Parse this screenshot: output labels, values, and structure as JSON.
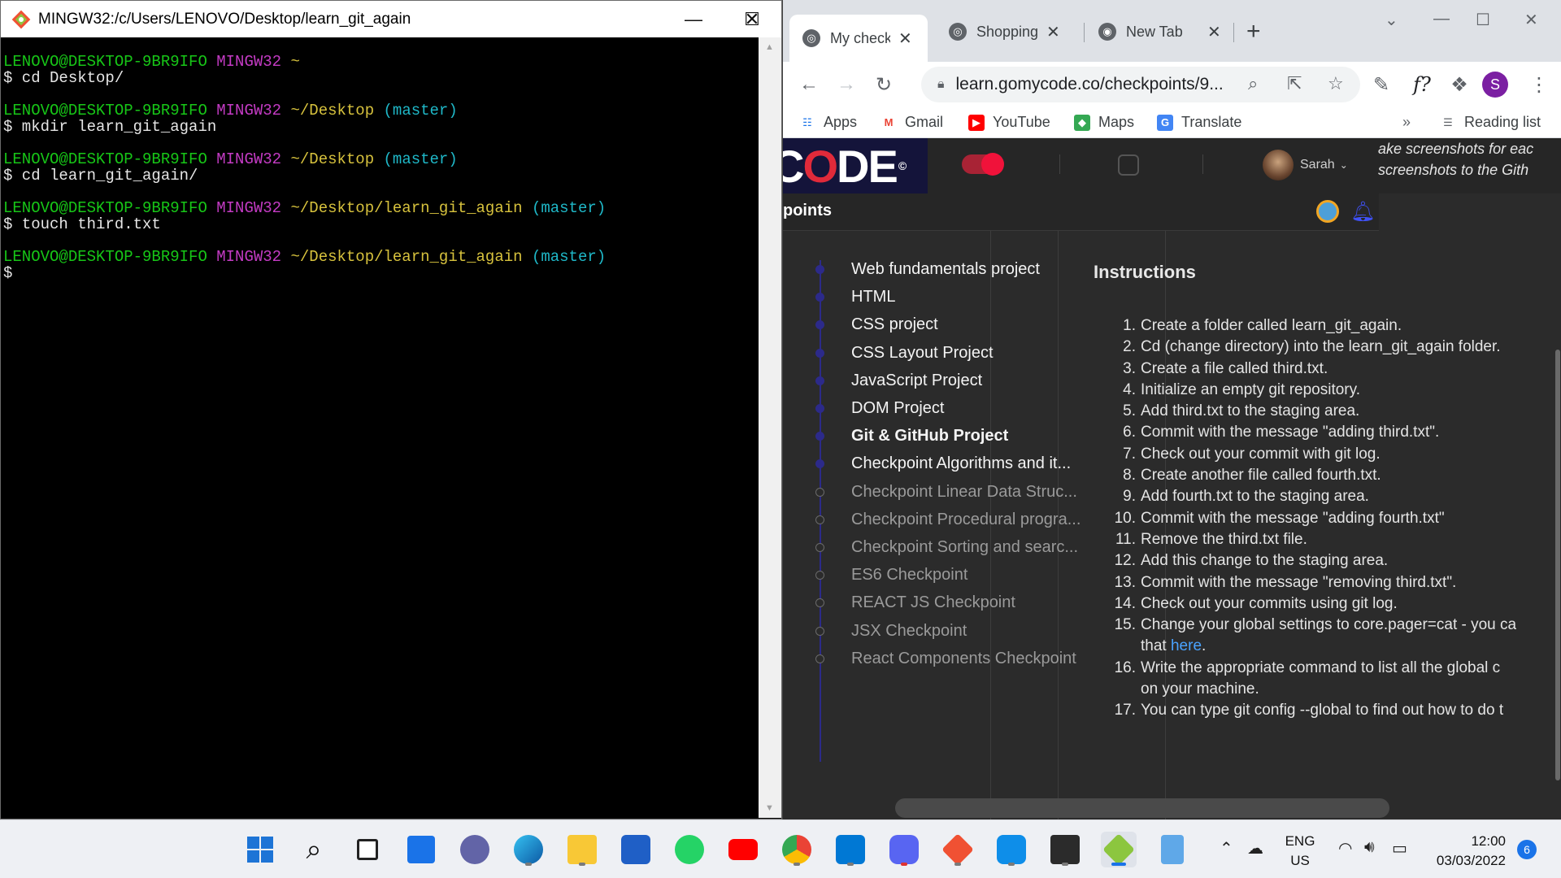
{
  "terminal": {
    "title": "MINGW32:/c/Users/LENOVO/Desktop/learn_git_again",
    "lines": [
      {
        "user": "LENOVO@DESKTOP-9BR9IFO",
        "sys": "MINGW32",
        "path": "~",
        "branch": ""
      },
      {
        "cmd": "$ cd Desktop/"
      },
      {
        "blank": ""
      },
      {
        "user": "LENOVO@DESKTOP-9BR9IFO",
        "sys": "MINGW32",
        "path": "~/Desktop",
        "branch": "(master)"
      },
      {
        "cmd": "$ mkdir learn_git_again"
      },
      {
        "blank": ""
      },
      {
        "user": "LENOVO@DESKTOP-9BR9IFO",
        "sys": "MINGW32",
        "path": "~/Desktop",
        "branch": "(master)"
      },
      {
        "cmd": "$ cd learn_git_again/"
      },
      {
        "blank": ""
      },
      {
        "user": "LENOVO@DESKTOP-9BR9IFO",
        "sys": "MINGW32",
        "path": "~/Desktop/learn_git_again",
        "branch": "(master)"
      },
      {
        "cmd": "$ touch third.txt"
      },
      {
        "blank": ""
      },
      {
        "user": "LENOVO@DESKTOP-9BR9IFO",
        "sys": "MINGW32",
        "path": "~/Desktop/learn_git_again",
        "branch": "(master)"
      },
      {
        "cmd": "$"
      }
    ]
  },
  "browser": {
    "tabs": [
      {
        "label": "My checkp",
        "icon": "globe-icon",
        "active": true
      },
      {
        "label": "Shopping",
        "icon": "globe-icon",
        "active": false
      },
      {
        "label": "New Tab",
        "icon": "chrome-icon",
        "active": false
      }
    ],
    "url": "learn.gomycode.co/checkpoints/9...",
    "profile_initial": "S",
    "bookmarks": [
      "Apps",
      "Gmail",
      "YouTube",
      "Maps",
      "Translate"
    ],
    "reading_list": "Reading list"
  },
  "site": {
    "logo_text": "CODE",
    "logo_mark": "©",
    "user_name": "Sarah",
    "overflow_lines": [
      "ake screenshots for eac",
      "screenshots to the Gith"
    ],
    "breadcrumb": "points",
    "steps": [
      {
        "label": "Web fundamentals project",
        "state": "done"
      },
      {
        "label": "HTML",
        "state": "done"
      },
      {
        "label": "CSS project",
        "state": "done"
      },
      {
        "label": "CSS Layout Project",
        "state": "done"
      },
      {
        "label": "JavaScript Project",
        "state": "done"
      },
      {
        "label": "DOM Project",
        "state": "done"
      },
      {
        "label": "Git & GitHub Project",
        "state": "current"
      },
      {
        "label": "Checkpoint Algorithms and it...",
        "state": "done"
      },
      {
        "label": "Checkpoint Linear Data Struc...",
        "state": "todo"
      },
      {
        "label": "Checkpoint Procedural progra...",
        "state": "todo"
      },
      {
        "label": "Checkpoint Sorting and searc...",
        "state": "todo"
      },
      {
        "label": "ES6 Checkpoint",
        "state": "todo"
      },
      {
        "label": "REACT JS Checkpoint",
        "state": "todo"
      },
      {
        "label": "JSX Checkpoint",
        "state": "todo"
      },
      {
        "label": "React Components Checkpoint",
        "state": "todo"
      }
    ],
    "instructions_title": "Instructions",
    "instructions": [
      {
        "n": "1.",
        "t": "Create a folder called learn_git_again."
      },
      {
        "n": "2.",
        "t": "Cd (change directory) into the learn_git_again folder."
      },
      {
        "n": "3.",
        "t": "Create a file called third.txt."
      },
      {
        "n": "4.",
        "t": "Initialize an empty git repository."
      },
      {
        "n": "5.",
        "t": "Add third.txt to the staging area."
      },
      {
        "n": "6.",
        "t": "Commit with the message \"adding third.txt\"."
      },
      {
        "n": "7.",
        "t": "Check out your commit with git log."
      },
      {
        "n": "8.",
        "t": "Create another file called fourth.txt."
      },
      {
        "n": "9.",
        "t": "Add fourth.txt to the staging area."
      },
      {
        "n": "10.",
        "t": "Commit with the message \"adding fourth.txt\""
      },
      {
        "n": "11.",
        "t": "Remove the third.txt file."
      },
      {
        "n": "12.",
        "t": "Add this change to the staging area."
      },
      {
        "n": "13.",
        "t": "Commit with the message \"removing third.txt\"."
      },
      {
        "n": "14.",
        "t": "Check out your commits using git log."
      },
      {
        "n": "15.",
        "t": "Change your global settings to core.pager=cat - you ca"
      },
      {
        "n": "",
        "t": "that ",
        "link": "here",
        "after": "."
      },
      {
        "n": "16.",
        "t": "Write the appropriate  command to list all the global c"
      },
      {
        "n": "",
        "t": "on your machine."
      },
      {
        "n": "17.",
        "t": "You can type git config --global to find out how to do t"
      }
    ]
  },
  "taskbar": {
    "apps": [
      "windows-start-icon",
      "search-icon",
      "task-view-icon",
      "widgets-icon",
      "teams-chat-icon",
      "edge-icon",
      "file-explorer-icon",
      "store-icon",
      "whatsapp-icon",
      "youtube-icon",
      "chrome-icon",
      "vscode-icon",
      "discord-icon",
      "git-gui-icon",
      "teamviewer-icon",
      "terminal-icon",
      "git-bash-icon",
      "notepad-icon"
    ],
    "lang_1": "ENG",
    "lang_2": "US",
    "time": "12:00",
    "date": "03/03/2022",
    "notifications": "6"
  },
  "colors": {
    "term_green": "#17c617",
    "term_magenta": "#c43bc4",
    "term_yellow": "#d7c23d",
    "term_cyan": "#1fb8c8",
    "brand_red": "#e02a3a",
    "timeline_blue": "#2c2a8a",
    "link_blue": "#4aa3ff"
  }
}
